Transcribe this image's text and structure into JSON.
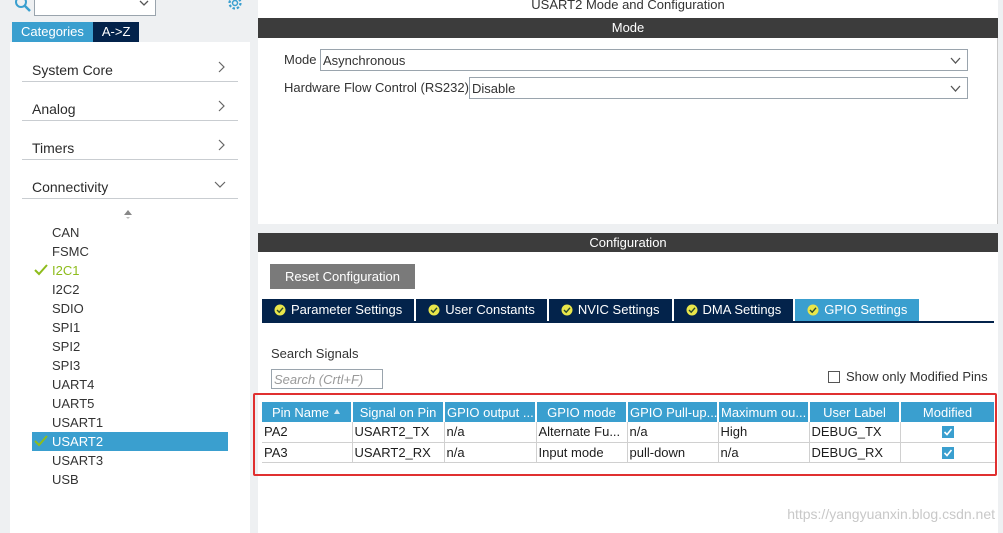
{
  "left_panel": {
    "tabs": [
      "Categories",
      "A->Z"
    ],
    "categories": [
      {
        "label": "System Core",
        "expanded": false
      },
      {
        "label": "Analog",
        "expanded": false
      },
      {
        "label": "Timers",
        "expanded": false
      },
      {
        "label": "Connectivity",
        "expanded": true
      }
    ],
    "peripherals": [
      {
        "label": "CAN",
        "state": "normal"
      },
      {
        "label": "FSMC",
        "state": "normal"
      },
      {
        "label": "I2C1",
        "state": "enabled"
      },
      {
        "label": "I2C2",
        "state": "normal"
      },
      {
        "label": "SDIO",
        "state": "normal"
      },
      {
        "label": "SPI1",
        "state": "normal"
      },
      {
        "label": "SPI2",
        "state": "normal"
      },
      {
        "label": "SPI3",
        "state": "normal"
      },
      {
        "label": "UART4",
        "state": "normal"
      },
      {
        "label": "UART5",
        "state": "normal"
      },
      {
        "label": "USART1",
        "state": "normal"
      },
      {
        "label": "USART2",
        "state": "selected"
      },
      {
        "label": "USART3",
        "state": "normal"
      },
      {
        "label": "USB",
        "state": "normal"
      }
    ]
  },
  "main": {
    "title": "USART2 Mode and Configuration",
    "mode_header": "Mode",
    "mode_label": "Mode",
    "mode_value": "Asynchronous",
    "hwflow_label": "Hardware Flow Control (RS232)",
    "hwflow_value": "Disable",
    "config_header": "Configuration",
    "reset_button": "Reset Configuration",
    "tabs": [
      {
        "label": "Parameter Settings",
        "active": false
      },
      {
        "label": "User Constants",
        "active": false
      },
      {
        "label": "NVIC Settings",
        "active": false
      },
      {
        "label": "DMA Settings",
        "active": false
      },
      {
        "label": "GPIO Settings",
        "active": true
      }
    ],
    "search_signals_label": "Search Signals",
    "search_signals_placeholder": "Search (Crtl+F)",
    "show_modified_label": "Show only Modified Pins"
  },
  "gpio_table": {
    "headers": [
      "Pin Name",
      "Signal on Pin",
      "GPIO output ...",
      "GPIO mode",
      "GPIO Pull-up...",
      "Maximum ou...",
      "User Label",
      "Modified"
    ],
    "rows": [
      {
        "pin": "PA2",
        "signal": "USART2_TX",
        "output": "n/a",
        "mode": "Alternate Fu...",
        "pull": "n/a",
        "speed": "High",
        "label": "DEBUG_TX",
        "modified": true
      },
      {
        "pin": "PA3",
        "signal": "USART2_RX",
        "output": "n/a",
        "mode": "Input mode",
        "pull": "pull-down",
        "speed": "n/a",
        "label": "DEBUG_RX",
        "modified": true
      }
    ]
  },
  "watermark": "https://yangyuanxin.blog.csdn.net",
  "colors": {
    "accent": "#3a9fcf",
    "navy": "#03234b",
    "header_dark": "#3c3c3c",
    "enabled_green": "#8ebc1c",
    "highlight_red": "#e03030"
  }
}
